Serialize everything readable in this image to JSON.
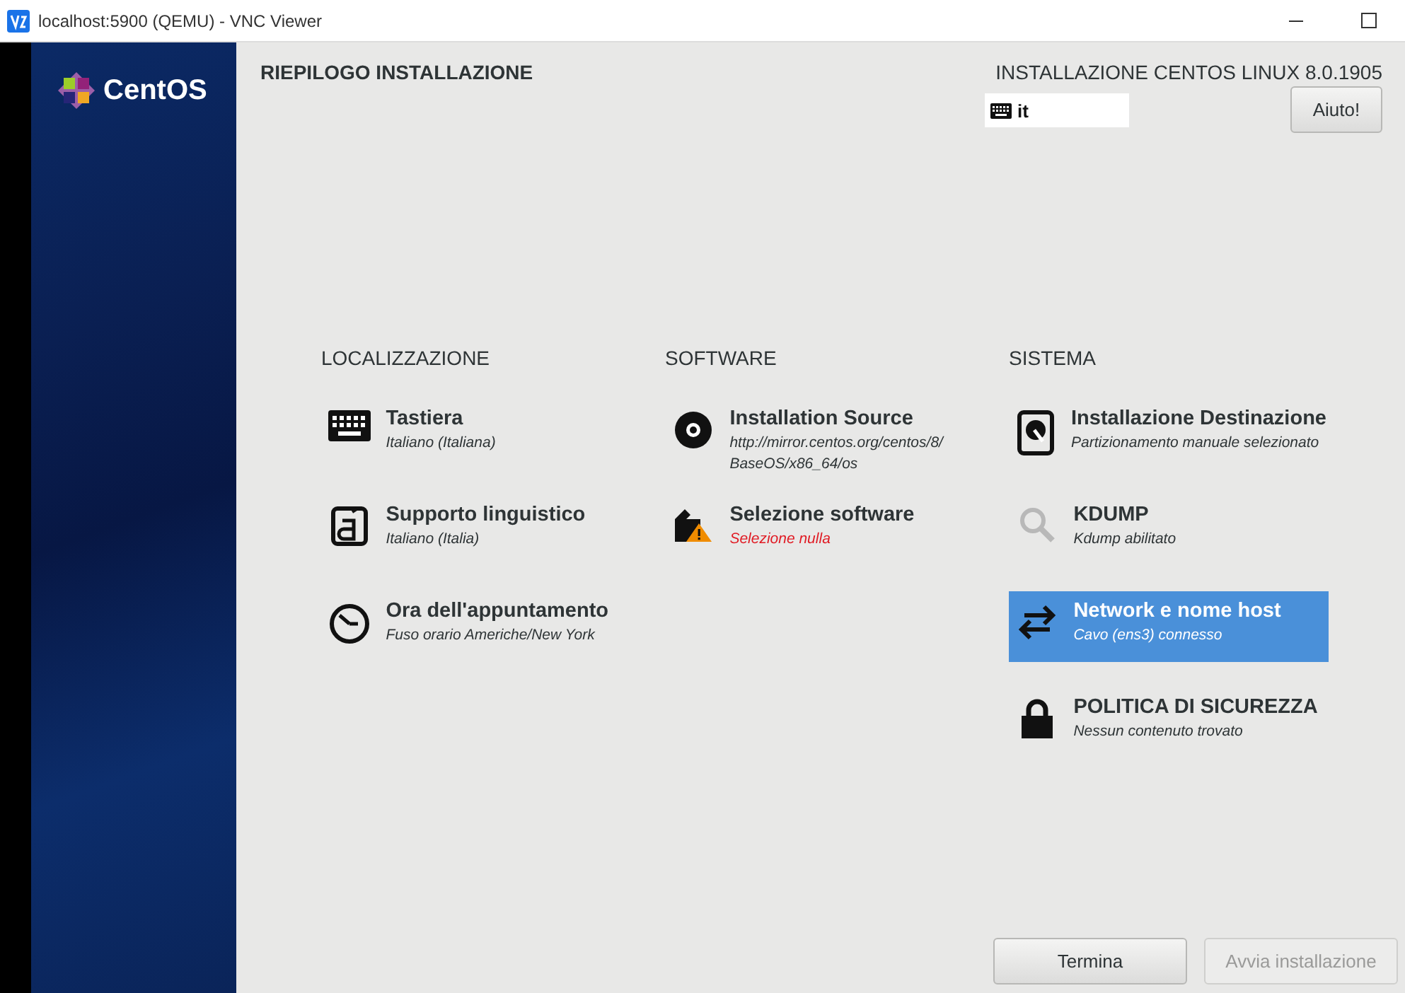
{
  "window": {
    "title": "localhost:5900 (QEMU) - VNC Viewer"
  },
  "sidebar": {
    "logo_text": "CentOS"
  },
  "header": {
    "title": "RIEPILOGO INSTALLAZIONE",
    "product": "INSTALLAZIONE CENTOS LINUX 8.0.1905",
    "keyboard_layout": "it",
    "help_button": "Aiuto!"
  },
  "categories": [
    {
      "title": "LOCALIZZAZIONE",
      "spokes": [
        {
          "title": "Tastiera",
          "status": "Italiano (Italiana)",
          "warning": false,
          "selected": false
        },
        {
          "title": "Supporto linguistico",
          "status": "Italiano (Italia)",
          "warning": false,
          "selected": false
        },
        {
          "title": "Ora dell'appuntamento",
          "status": "Fuso orario Americhe/New York",
          "warning": false,
          "selected": false
        }
      ]
    },
    {
      "title": "SOFTWARE",
      "spokes": [
        {
          "title": "Installation Source",
          "status": "http://mirror.centos.org/centos/8/ BaseOS/x86_64/os",
          "warning": false,
          "selected": false
        },
        {
          "title": "Selezione software",
          "status": "Selezione nulla",
          "warning": true,
          "selected": false
        }
      ]
    },
    {
      "title": "SISTEMA",
      "spokes": [
        {
          "title": "Installazione Destinazione",
          "status": "Partizionamento manuale selezionato",
          "warning": false,
          "selected": false
        },
        {
          "title": "KDUMP",
          "status": "Kdump abilitato",
          "warning": false,
          "selected": false
        },
        {
          "title": "Network e nome host",
          "status": "Cavo (ens3) connesso",
          "warning": false,
          "selected": true
        },
        {
          "title": "POLITICA DI SICUREZZA",
          "status": "Nessun contenuto trovato",
          "warning": false,
          "selected": false
        }
      ]
    }
  ],
  "footer": {
    "buttons": [
      {
        "label": "Termina",
        "disabled": false
      },
      {
        "label": "Avvia installazione",
        "disabled": true
      }
    ]
  }
}
